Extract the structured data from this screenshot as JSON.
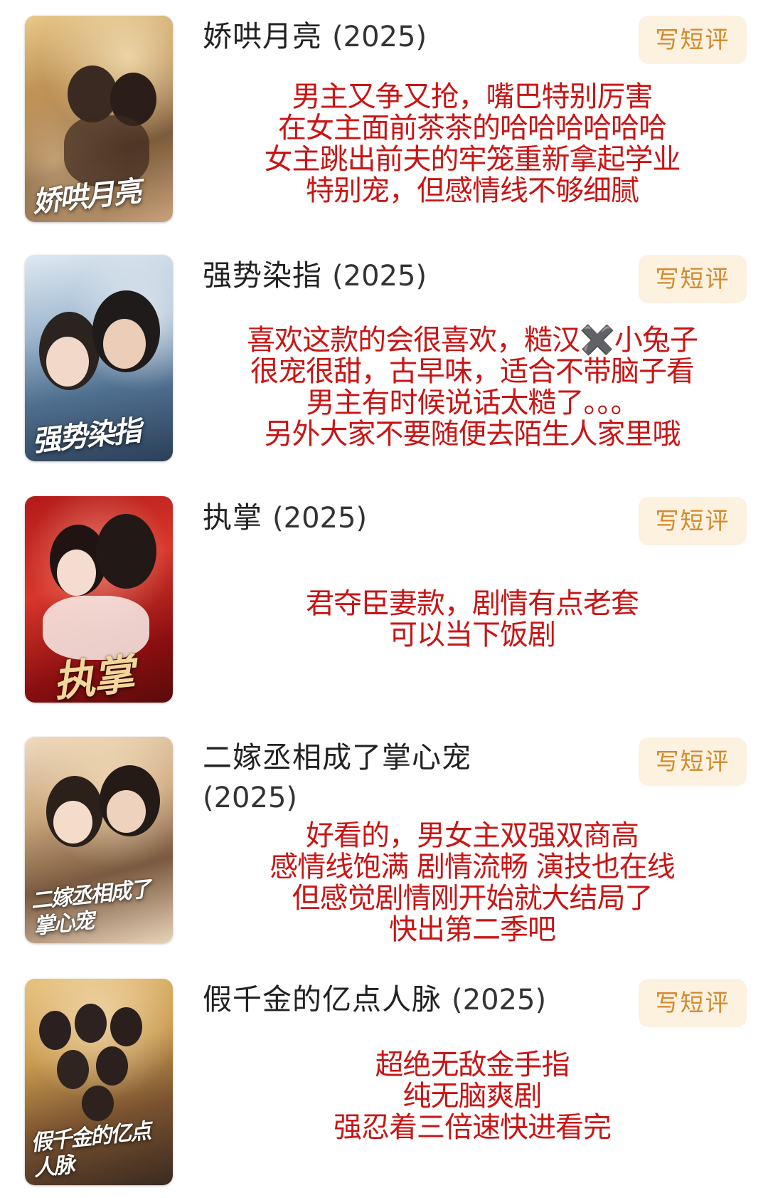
{
  "accent_color": "#c91515",
  "button_bg": "#fdf1e0",
  "button_text_color": "#d4892a",
  "items": [
    {
      "title": "娇哄月亮",
      "year": "(2025)",
      "button": "写短评",
      "poster_logo": "娇哄月亮",
      "comment": [
        "男主又争又抢，嘴巴特别厉害",
        "在女主面前茶茶的哈哈哈哈哈哈",
        "女主跳出前夫的牢笼重新拿起学业",
        "特别宠，但感情线不够细腻"
      ]
    },
    {
      "title": "强势染指",
      "year": "(2025)",
      "button": "写短评",
      "poster_logo": "强势染指",
      "comment": [
        "喜欢这款的会很喜欢，糙汉✖️小兔子",
        "很宠很甜，古早味，适合不带脑子看",
        "男主有时候说话太糙了。。。",
        "另外大家不要随便去陌生人家里哦"
      ]
    },
    {
      "title": "执掌",
      "year": "(2025)",
      "button": "写短评",
      "poster_logo": "执掌",
      "comment": [
        "君夺臣妻款，剧情有点老套",
        "可以当下饭剧"
      ]
    },
    {
      "title": "二嫁丞相成了掌心宠",
      "year": "(2025)",
      "button": "写短评",
      "poster_logo": "二嫁丞相成了掌心宠",
      "comment": [
        "好看的，男女主双强双商高",
        "感情线饱满 剧情流畅 演技也在线",
        "但感觉剧情刚开始就大结局了",
        "快出第二季吧"
      ]
    },
    {
      "title": "假千金的亿点人脉",
      "year": "(2025)",
      "button": "写短评",
      "poster_logo": "假千金的亿点人脉",
      "comment": [
        "超绝无敌金手指",
        "纯无脑爽剧",
        "强忍着三倍速快进看完"
      ]
    }
  ]
}
